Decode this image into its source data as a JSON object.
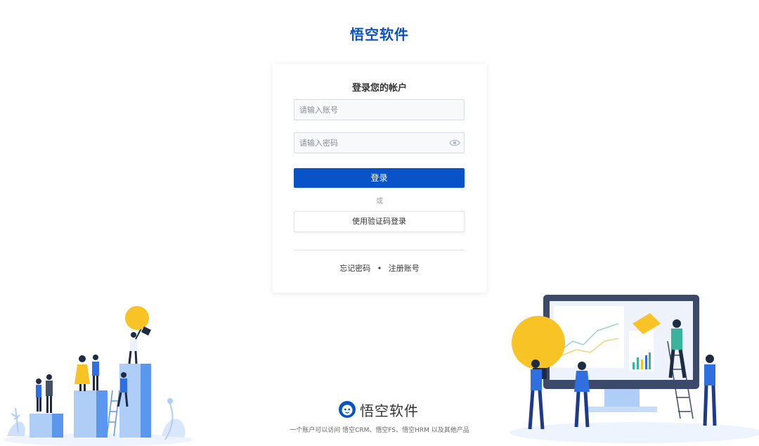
{
  "brand": {
    "title": "悟空软件"
  },
  "login": {
    "heading": "登录您的帐户",
    "account_placeholder": "请输入账号",
    "password_placeholder": "请输入密码",
    "submit_label": "登录",
    "or_text": "或",
    "sms_login_label": "使用验证码登录",
    "forgot_password": "忘记密码",
    "separator": "•",
    "register": "注册账号"
  },
  "footer": {
    "logo_text": "悟空软件",
    "tagline": "一个账户可以访问 悟空CRM、悟空FS、悟空HRM 以及其他产品"
  },
  "colors": {
    "brand": "#0a52c7",
    "accent_yellow": "#f7c325",
    "light_blue": "#aecdf7"
  },
  "icons": {
    "password_toggle": "eye-icon",
    "footer_logo": "monkey-logo-icon"
  }
}
